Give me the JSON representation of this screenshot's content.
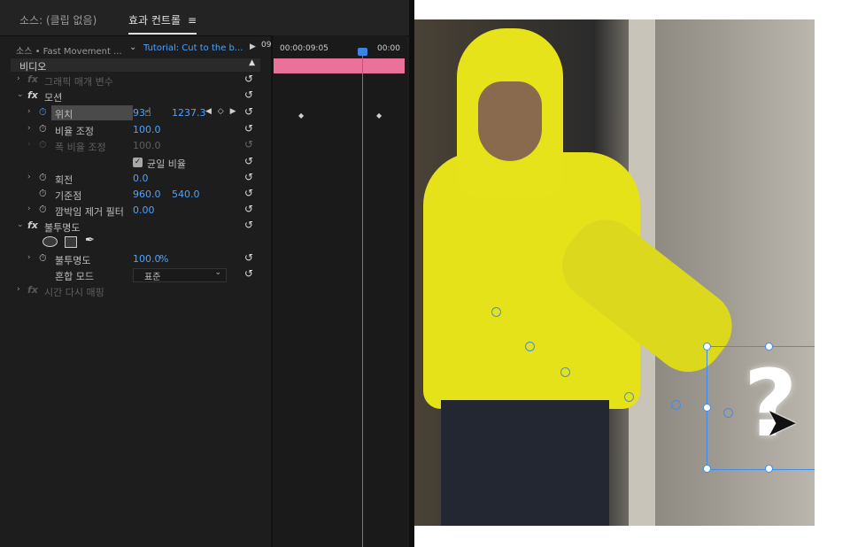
{
  "tabs": {
    "source": "소스: (클립 없음)",
    "effect_controls": "효과 컨트롤",
    "menu": "≡"
  },
  "header": {
    "source_clip": "소스 • Fast Movement ...",
    "sequence": "Tutorial: Cut to the b...",
    "timecode_left": "09:",
    "timecode_main": "00:00:09:05",
    "timecode_right": "00:00"
  },
  "section": {
    "video": "비디오"
  },
  "props": {
    "graphic_params": "그래픽 매개 변수",
    "motion": "모션",
    "position": {
      "label": "위치",
      "x": "93",
      "y": "1237.3"
    },
    "scale": {
      "label": "비율 조정",
      "value": "100.0"
    },
    "scale_width": {
      "label": "폭 비율 조정",
      "value": "100.0"
    },
    "uniform_scale": "균일 비율",
    "rotation": {
      "label": "회전",
      "value": "0.0"
    },
    "anchor": {
      "label": "기준점",
      "x": "960.0",
      "y": "540.0"
    },
    "anti_flicker": {
      "label": "깜박임 제거 필터",
      "value": "0.00"
    },
    "opacity_fx": "불투명도",
    "opacity": {
      "label": "불투명도",
      "value": "100.0",
      "unit": "%"
    },
    "blend_mode": {
      "label": "혼합 모드",
      "value": "표준"
    },
    "time_remap": "시간 다시 매핑"
  },
  "icons": {
    "reset": "reset-icon",
    "stopwatch": "stopwatch-icon",
    "chevron": "chevron-icon",
    "fx": "fx-badge",
    "keyframe": "keyframe-icon"
  },
  "glyphs": {
    "chevron_right": "›",
    "chevron_down": "⌄",
    "caret_up": "▲",
    "play": "▶",
    "stopwatch": "⏱",
    "reset": "↺",
    "keyframe": "◆",
    "kf_nav": "◀ ◇ ▶",
    "check": "✓",
    "pen": "✒",
    "dropdown": "⌄",
    "hand": "☝",
    "arrow": "➤",
    "fx": "fx"
  },
  "overlay": {
    "qmark": "?"
  },
  "colors": {
    "accent_blue": "#4da3ff",
    "timeline_clip": "#e9719a",
    "playhead": "#3b84e6",
    "hoodie": "#e6e21a"
  }
}
